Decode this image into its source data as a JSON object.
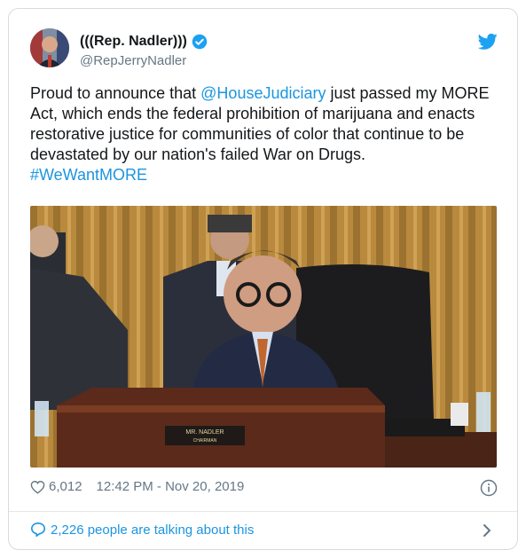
{
  "tweet": {
    "display_name": "(((Rep. Nadler)))",
    "handle": "@RepJerryNadler",
    "text_before": "Proud to announce that ",
    "mention": "@HouseJudiciary",
    "text_after": " just passed my MORE Act, which ends the federal prohibition of marijuana and enacts restorative justice for communities of color that continue to be devastated by our nation's failed War on Drugs.",
    "hashtag": "#WeWantMORE",
    "likes": "6,012",
    "timestamp": "12:42 PM - Nov 20, 2019",
    "talking": "2,226 people are talking about this"
  },
  "media": {
    "nameplate_line1": "MR. NADLER",
    "nameplate_line2": "CHAIRMAN"
  },
  "colors": {
    "link": "#1b95e0",
    "secondary_text": "#657786",
    "border": "#d6dbe0"
  },
  "icons": [
    "verified-badge-icon",
    "twitter-bird-icon",
    "heart-icon",
    "info-icon",
    "speech-bubble-icon",
    "chevron-right-icon"
  ]
}
